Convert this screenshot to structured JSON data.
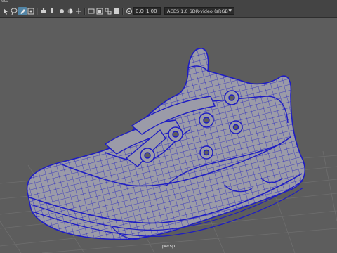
{
  "menu": {
    "label": "ets"
  },
  "toolbar": {
    "tools": [
      {
        "name": "select-tool-icon",
        "active": false
      },
      {
        "name": "lasso-icon",
        "active": false
      },
      {
        "name": "paint-select-icon",
        "active": true
      },
      {
        "name": "move-icon",
        "active": false
      },
      {
        "name": "camera-icon",
        "active": false
      },
      {
        "name": "bookmark-icon",
        "active": false
      },
      {
        "name": "light-icon",
        "active": false
      },
      {
        "name": "shading-icon",
        "active": false
      },
      {
        "name": "grid-icon",
        "active": false
      },
      {
        "name": "film-gate-icon",
        "active": false
      },
      {
        "name": "resolution-gate-icon",
        "active": false
      },
      {
        "name": "wireframe-icon",
        "active": false
      },
      {
        "name": "smooth-shade-icon",
        "active": false
      },
      {
        "name": "textured-icon",
        "active": false
      },
      {
        "name": "lights-icon",
        "active": false
      },
      {
        "name": "shadows-icon",
        "active": false
      },
      {
        "name": "isolate-icon",
        "active": false
      },
      {
        "name": "xray-icon",
        "active": false
      }
    ],
    "exposure_value": "0.00",
    "gamma_value": "1.00",
    "color_space": "ACES 1.0 SDR-video (sRGB"
  },
  "viewport": {
    "camera_label": "persp",
    "background_color": "#5d5d5d",
    "grid_color": "#6e6e6e",
    "wire_color": "#1e1cc4",
    "mesh_color": "#9b9ba8"
  }
}
